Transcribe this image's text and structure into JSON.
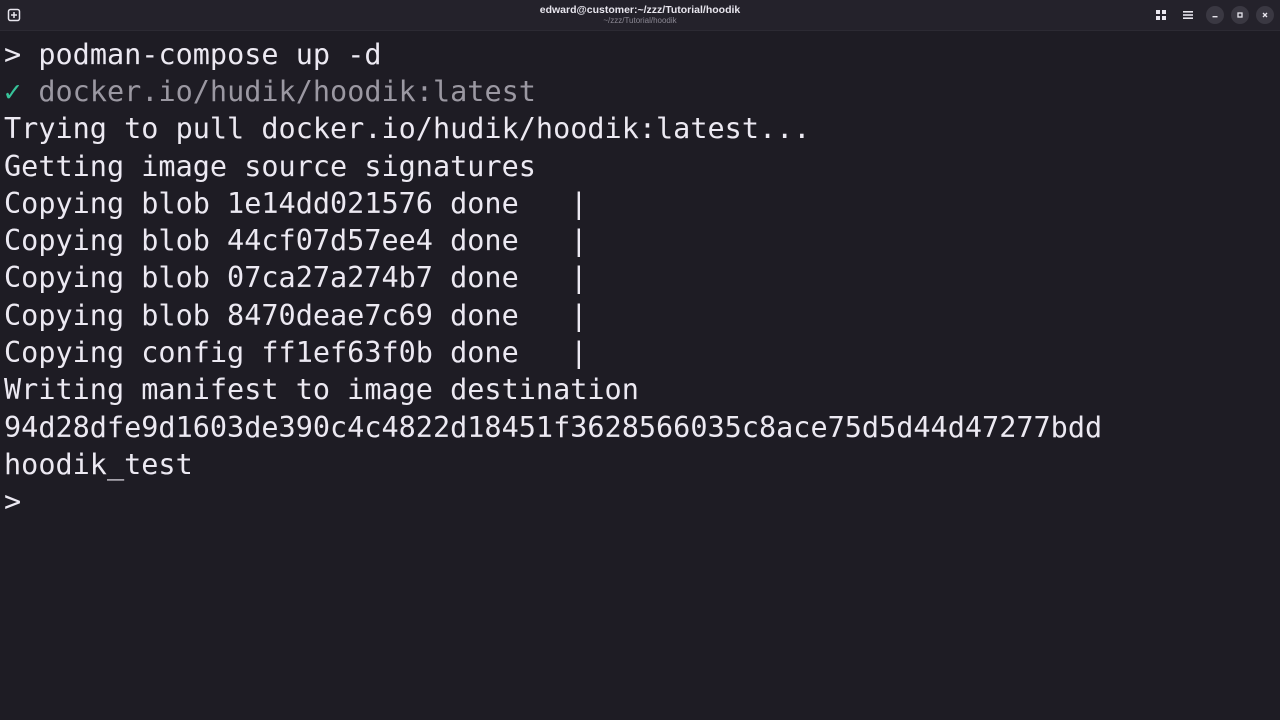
{
  "window": {
    "title": "edward@customer:~/zzz/Tutorial/hoodik",
    "subtitle": "~/zzz/Tutorial/hoodik"
  },
  "colors": {
    "background": "#1e1c24",
    "titlebar": "#24222b",
    "text": "#ece9f2",
    "success_check": "#37c39a",
    "dim_text": "#9b98a2"
  },
  "icons": {
    "new_tab": "new-tab-icon",
    "tiles": "tiles-icon",
    "menu": "hamburger-menu-icon",
    "minimize": "minimize-icon",
    "maximize": "maximize-icon",
    "close": "close-icon"
  },
  "terminal": {
    "prompt_symbol": ">",
    "command": "podman-compose up -d",
    "check_symbol": "✓",
    "pull_target": "docker.io/hudik/hoodik:latest",
    "output_lines": [
      "Trying to pull docker.io/hudik/hoodik:latest...",
      "Getting image source signatures",
      "Copying blob 1e14dd021576 done   |",
      "Copying blob 44cf07d57ee4 done   |",
      "Copying blob 07ca27a274b7 done   |",
      "Copying blob 8470deae7c69 done   |",
      "Copying config ff1ef63f0b done   |",
      "Writing manifest to image destination",
      "94d28dfe9d1603de390c4c4822d18451f3628566035c8ace75d5d44d47277bdd",
      "hoodik_test"
    ],
    "final_prompt": ">"
  }
}
